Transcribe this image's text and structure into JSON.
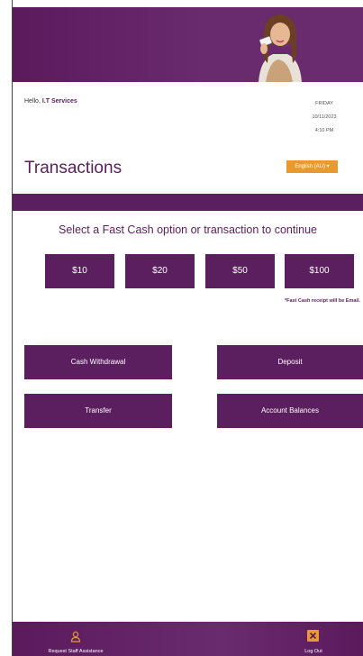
{
  "header": {
    "greeting_prefix": "Hello, ",
    "user_name": "I.T Services",
    "day": "FRIDAY",
    "date": "10/11/2023",
    "time": "4:10 PM"
  },
  "page": {
    "title": "Transactions",
    "language": "English (AU) ▾",
    "prompt": "Select a Fast Cash option or transaction to continue",
    "fast_cash_note": "*Fast Cash receipt will be Email."
  },
  "fast_cash": [
    "$10",
    "$20",
    "$50",
    "$100"
  ],
  "transactions": [
    "Cash Withdrawal",
    "Deposit",
    "Transfer",
    "Account Balances"
  ],
  "footer": {
    "assist_label": "Request Staff Assistance",
    "logout_label": "Log Out",
    "assist_icon": "person-icon",
    "logout_icon": "close-icon"
  },
  "colors": {
    "brand_purple": "#5b1e5e",
    "accent_orange": "#e89a2e"
  }
}
